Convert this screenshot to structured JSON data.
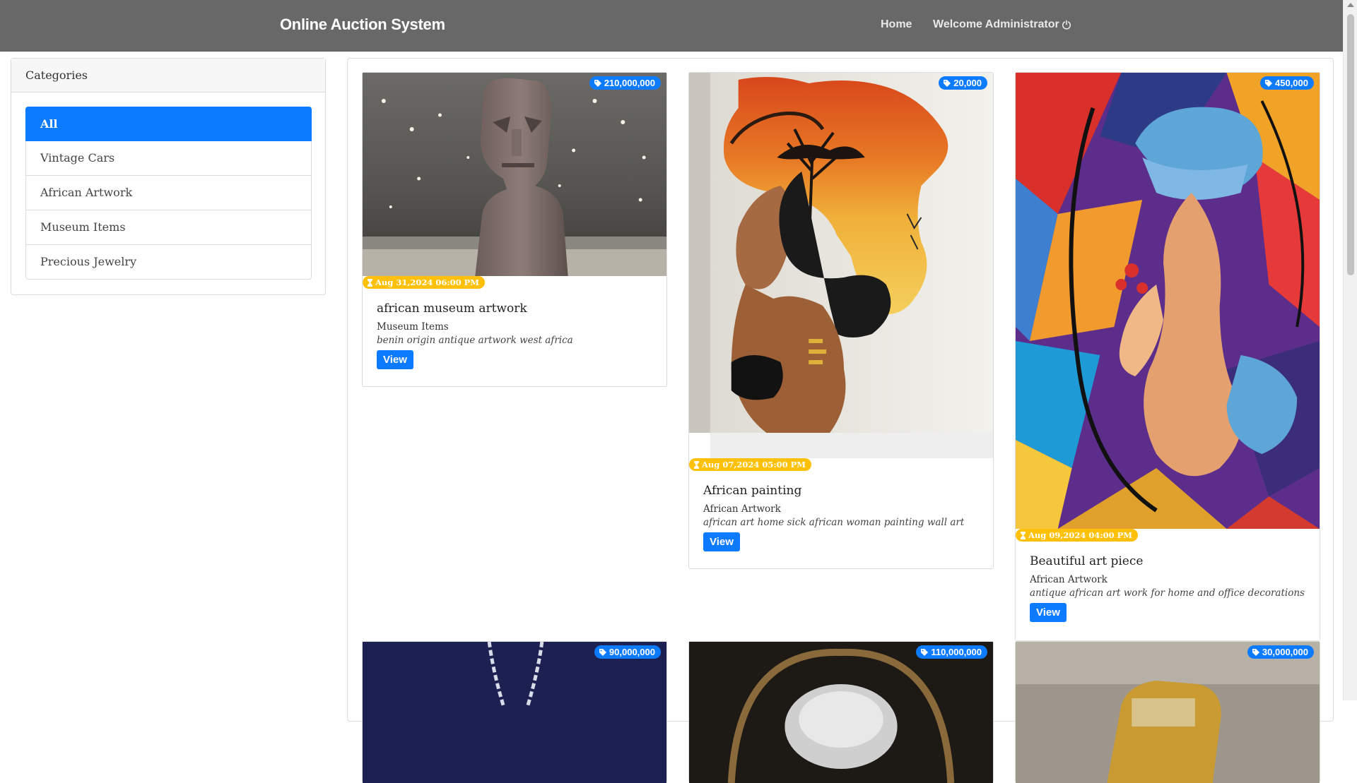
{
  "navbar": {
    "brand": "Online Auction System",
    "home": "Home",
    "welcome": "Welcome Administrator"
  },
  "sidebar": {
    "header": "Categories",
    "items": [
      {
        "label": "All",
        "active": true
      },
      {
        "label": "Vintage Cars",
        "active": false
      },
      {
        "label": "African Artwork",
        "active": false
      },
      {
        "label": "Museum Items",
        "active": false
      },
      {
        "label": "Precious Jewelry",
        "active": false
      }
    ]
  },
  "products": [
    {
      "price": "210,000,000",
      "date": "Aug 31,2024 06:00 PM",
      "title": "african museum artwork",
      "category": "Museum Items",
      "description": "benin origin antique artwork west africa",
      "button": "View"
    },
    {
      "price": "20,000",
      "date": "Aug 07,2024 05:00 PM",
      "title": "African painting",
      "category": "African Artwork",
      "description": "african art home sick african woman painting wall art",
      "button": "View"
    },
    {
      "price": "450,000",
      "date": "Aug 09,2024 04:00 PM",
      "title": "Beautiful art piece",
      "category": "African Artwork",
      "description": "antique african art work for home and office decorations",
      "button": "View"
    },
    {
      "price": "90,000,000"
    },
    {
      "price": "110,000,000"
    },
    {
      "price": "30,000,000"
    }
  ],
  "colors": {
    "navbar": "#686868",
    "primary": "#0d7bff",
    "warning": "#ffc107"
  },
  "icons": [
    "power-icon",
    "tag-icon",
    "hourglass-icon"
  ]
}
